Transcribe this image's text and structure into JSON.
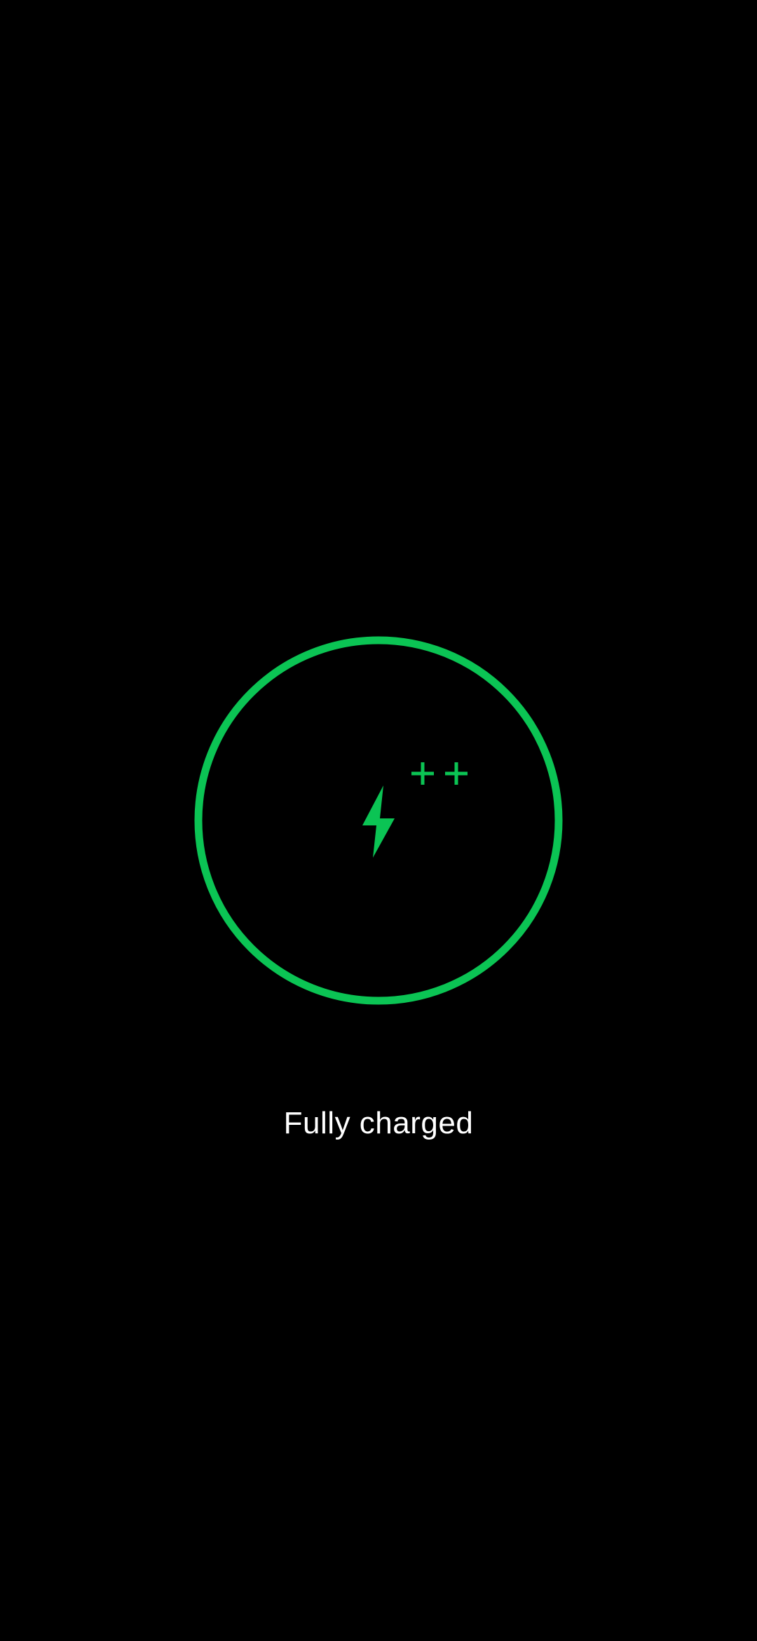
{
  "charging_screen": {
    "status_text": "Fully charged",
    "ring_icon": "ring-icon",
    "bolt_icon": "lightning-bolt-icon",
    "plus_icon": "plus-icon",
    "accent_color": "#0BC454",
    "background_color": "#000000",
    "text_color": "#FFFFFF"
  }
}
